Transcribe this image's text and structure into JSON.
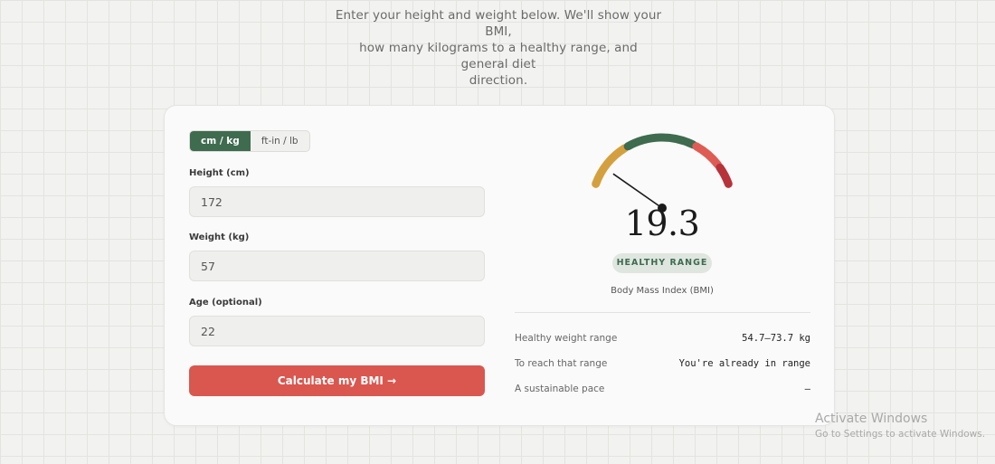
{
  "intro": {
    "line1": "Enter your height and weight below. We'll show your BMI,",
    "line2": "how many kilograms to a healthy range, and general diet",
    "line3": "direction."
  },
  "form": {
    "units": [
      {
        "label": "cm / kg",
        "active": true
      },
      {
        "label": "ft-in / lb",
        "active": false
      }
    ],
    "height": {
      "label": "Height (cm)",
      "value": "172"
    },
    "weight": {
      "label": "Weight (kg)",
      "value": "57"
    },
    "age": {
      "label": "Age (optional)",
      "value": "22"
    },
    "submit_label": "Calculate my BMI →"
  },
  "result": {
    "bmi_value": "19.3",
    "bmi_number": 19.3,
    "gauge_min": 15,
    "gauge_max": 40,
    "category": "HEALTHY RANGE",
    "caption": "Body Mass Index (BMI)",
    "gauge_colors": {
      "underweight": "#d4a03f",
      "healthy": "#3f6b4f",
      "overweight": "#de5c54",
      "obese": "#b8323a"
    }
  },
  "stats": [
    {
      "label": "Healthy weight range",
      "value": "54.7–73.7 kg"
    },
    {
      "label": "To reach that range",
      "value": "You're already in range"
    },
    {
      "label": "A sustainable pace",
      "value": "—"
    }
  ],
  "watermark": {
    "title": "Activate Windows",
    "subtitle": "Go to Settings to activate Windows."
  }
}
